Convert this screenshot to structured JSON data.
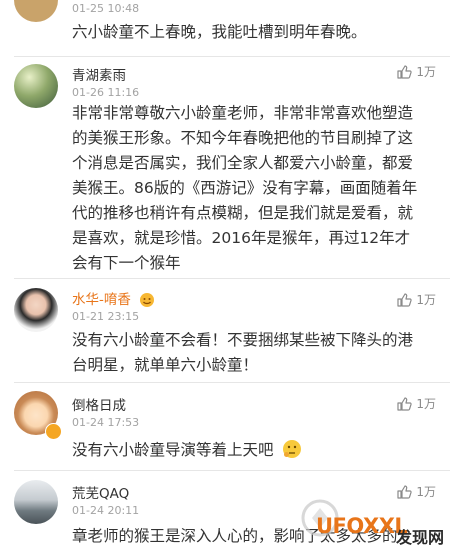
{
  "comments": [
    {
      "time": "01-25 10:48",
      "text": [
        "六小龄童不上春晚，我能吐槽到明年春晚。"
      ]
    },
    {
      "name": "青湖素雨",
      "time": "01-26 11:16",
      "likes": "1万",
      "text": [
        "非常非常尊敬六小龄童老师，非常非常喜欢他塑造",
        "的美猴王形象。不知今年春晚把他的节目刷掉了这",
        "个消息是否属实，我们全家人都爱六小龄童，都爱",
        "美猴王。86版的《西游记》没有字幕，画面随着年",
        "代的推移也稍许有点模糊，但是我们就是爱看，就",
        "是喜欢，就是珍惜。2016年是猴年，再过12年才",
        "会有下一个猴年"
      ]
    },
    {
      "name": "水华-唷香",
      "time": "01-21 23:15",
      "likes": "1万",
      "text": [
        "没有六小龄童不会看！不要捆绑某些被下降头的港",
        "台明星，就单单六小龄童！"
      ]
    },
    {
      "name": "倒格日成",
      "time": "01-24 17:53",
      "likes": "1万",
      "text": [
        "没有六小龄童导演等着上天吧"
      ]
    },
    {
      "name": "荒芜QAQ",
      "time": "01-24 20:11",
      "likes": "1万",
      "text": [
        "章老师的猴王是深入人心的，影响了太多太多的"
      ]
    }
  ],
  "watermark": {
    "brand": "UFOXXL",
    "site": "发现网"
  },
  "colors": {
    "name_text": "#333333",
    "time_text": "#a3a3a3",
    "like_gray": "#8a8a8a",
    "divider": "#e6e6e6",
    "vip_badge": "#f5a623",
    "watermark_orange": "#e8751a"
  }
}
